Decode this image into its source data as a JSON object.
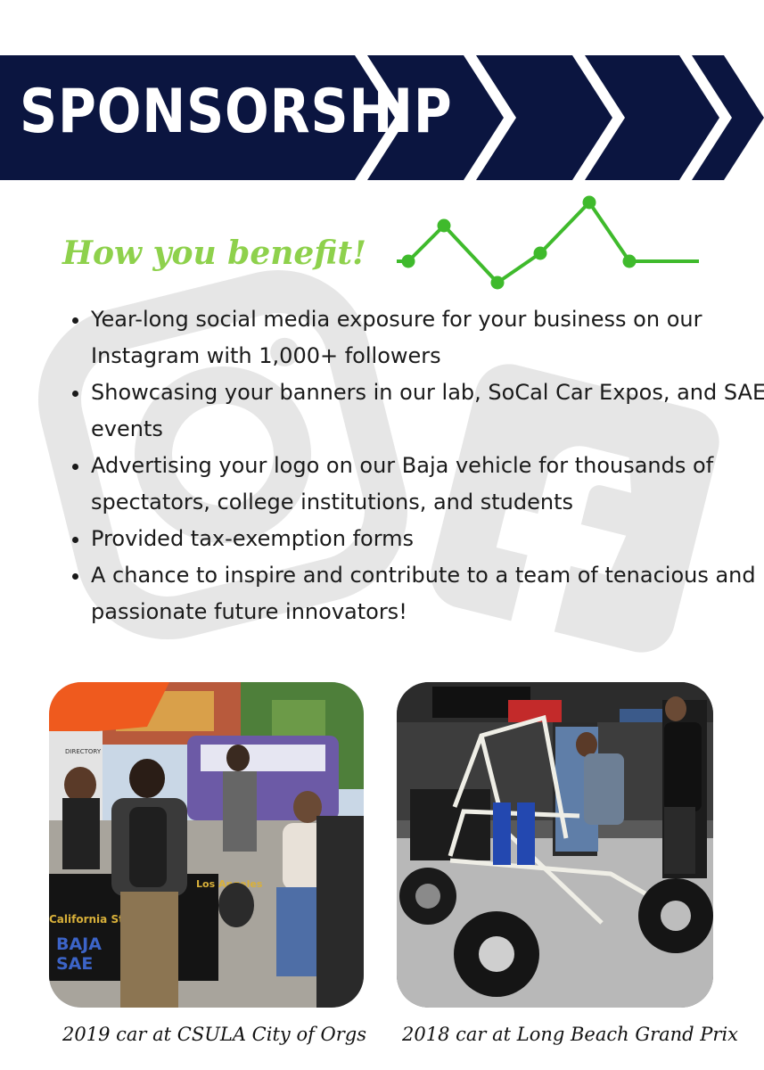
{
  "header": {
    "title": "SPONSORSHIP"
  },
  "benefits": {
    "heading": "How you benefit!",
    "items": [
      "Year-long social media exposure for your business on our Instagram with 1,000+ followers",
      "Showcasing your banners in our lab, SoCal Car Expos, and SAE events",
      "Advertising your logo on our Baja vehicle for thousands of spectators, college institutions, and students",
      "Provided tax-exemption forms",
      "A chance to inspire and contribute to a team of tenacious and passionate future innovators!"
    ]
  },
  "photos": {
    "left": {
      "caption": "2019 car at CSULA City of Orgs",
      "sign_text": [
        "DIRECTORY",
        "Los Angeles",
        "California Sta",
        "BAJA",
        "SAE"
      ]
    },
    "right": {
      "caption": "2018 car at Long Beach Grand Prix"
    }
  },
  "colors": {
    "navy": "#0b1540",
    "green": "#3fba2c",
    "script_green": "#8ed14c"
  },
  "icons": [
    "instagram-watermark-icon",
    "facebook-watermark-icon",
    "trend-line-icon"
  ]
}
